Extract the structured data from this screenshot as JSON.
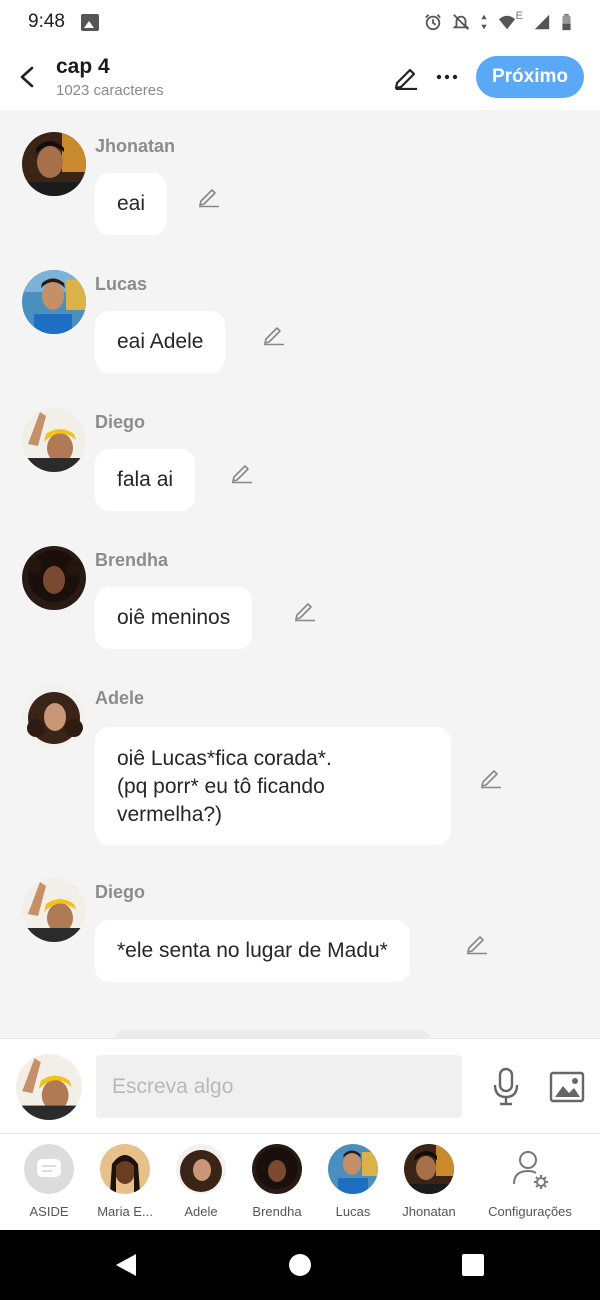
{
  "status_bar": {
    "time": "9:48",
    "network_letter": "E"
  },
  "header": {
    "title": "cap 4",
    "subtitle": "1023 caracteres",
    "next_label": "Próximo",
    "accent_color": "#5aa9f7"
  },
  "messages": [
    {
      "sender": "Jhonatan",
      "text": "eai"
    },
    {
      "sender": "Lucas",
      "text": "eai Adele"
    },
    {
      "sender": "Diego",
      "text": "fala ai"
    },
    {
      "sender": "Brendha",
      "text": "oiê meninos"
    },
    {
      "sender": "Adele",
      "text": "oiê Lucas*fica corada*.\n(pq porr* eu tô ficando\nvermelha?)"
    },
    {
      "sender": "Diego",
      "text": "*ele senta no lugar de Madu*"
    }
  ],
  "composer": {
    "placeholder": "Escreva algo"
  },
  "characters": [
    {
      "name": "ASIDE",
      "icon": "chat-bubble-icon"
    },
    {
      "name": "Maria E...",
      "icon": "avatar"
    },
    {
      "name": "Adele",
      "icon": "avatar"
    },
    {
      "name": "Brendha",
      "icon": "avatar"
    },
    {
      "name": "Lucas",
      "icon": "avatar"
    },
    {
      "name": "Jhonatan",
      "icon": "avatar"
    },
    {
      "name": "Configurações",
      "icon": "user-settings-icon"
    }
  ]
}
